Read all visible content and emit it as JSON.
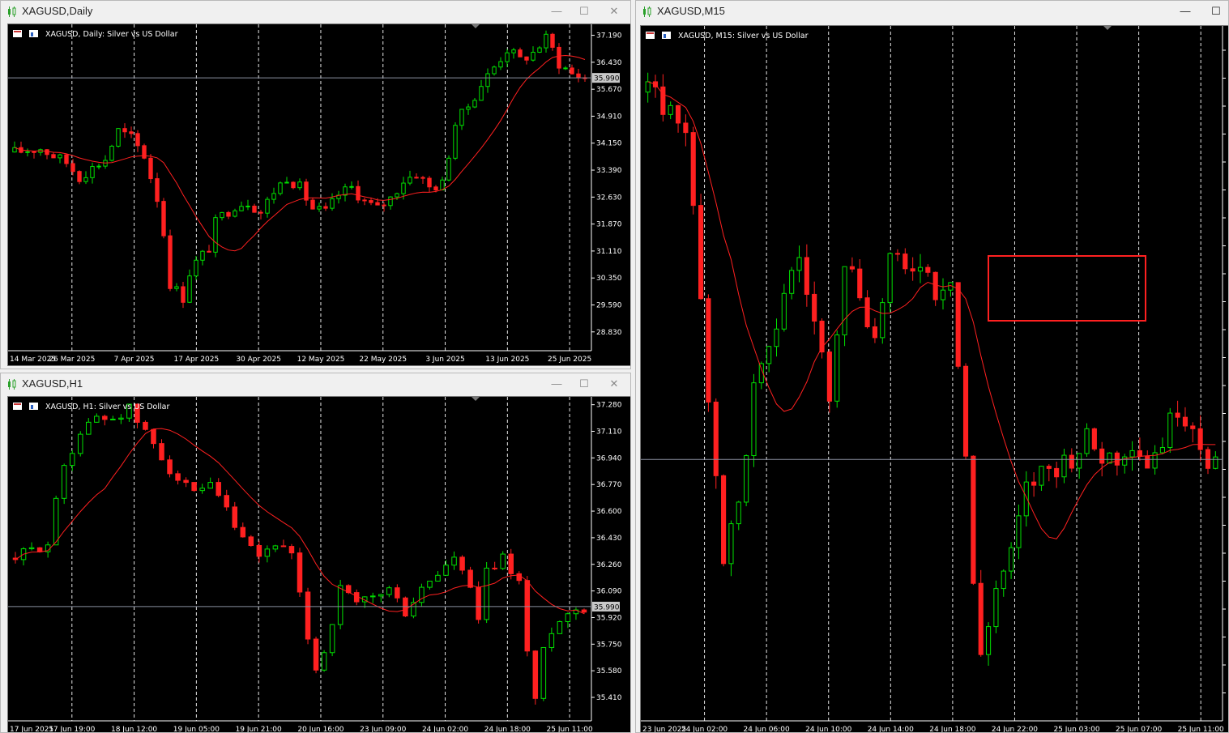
{
  "windows": {
    "daily": {
      "title": "XAGUSD,Daily",
      "chart_header": "XAGUSD, Daily:  Silver vs US Dollar"
    },
    "h1": {
      "title": "XAGUSD,H1",
      "chart_header": "XAGUSD, H1:  Silver vs US Dollar"
    },
    "m15": {
      "title": "XAGUSD,M15",
      "chart_header": "XAGUSD, M15:  Silver vs US Dollar"
    }
  },
  "controls": {
    "minimize": "—",
    "maximize": "☐",
    "close": "✕"
  },
  "colors": {
    "bull": "#00e000",
    "bear": "#ff2020",
    "ma": "#ff2020",
    "grid": "#ffffff",
    "price_line": "#8a8fa0",
    "box": "#ff2020",
    "background": "#000000"
  },
  "current_price": "35.990",
  "chart_data": [
    {
      "type": "candlestick",
      "title": "XAGUSD, Daily:  Silver vs US Dollar",
      "y_ticks": [
        "37.190",
        "36.430",
        "35.670",
        "34.910",
        "34.150",
        "33.390",
        "32.630",
        "31.870",
        "31.110",
        "30.350",
        "29.590",
        "28.830"
      ],
      "ylim": [
        28.3,
        37.5
      ],
      "x_labels": [
        "14 Mar 2025",
        "26 Mar 2025",
        "7 Apr 2025",
        "17 Apr 2025",
        "30 Apr 2025",
        "12 May 2025",
        "22 May 2025",
        "3 Jun 2025",
        "13 Jun 2025",
        "25 Jun 2025"
      ],
      "price_label": "35.990",
      "moving_average": true,
      "grid": "vertical dashed",
      "close_path": [
        [
          0,
          33.9
        ],
        [
          4,
          34.0
        ],
        [
          8,
          33.6
        ],
        [
          10,
          33.2
        ],
        [
          14,
          33.7
        ],
        [
          16,
          34.5
        ],
        [
          18,
          34.3
        ],
        [
          20,
          33.8
        ],
        [
          22,
          32.6
        ],
        [
          23,
          31.6
        ],
        [
          24,
          30.2
        ],
        [
          26,
          29.8
        ],
        [
          27,
          30.5
        ],
        [
          28,
          30.8
        ],
        [
          30,
          31.2
        ],
        [
          31,
          31.9
        ],
        [
          32,
          32.1
        ],
        [
          34,
          32.4
        ],
        [
          36,
          32.5
        ],
        [
          38,
          32.2
        ],
        [
          40,
          32.8
        ],
        [
          42,
          33.2
        ],
        [
          44,
          32.9
        ],
        [
          46,
          32.3
        ],
        [
          48,
          32.2
        ],
        [
          50,
          32.7
        ],
        [
          52,
          32.9
        ],
        [
          54,
          32.5
        ],
        [
          56,
          32.3
        ],
        [
          58,
          32.6
        ],
        [
          60,
          33.1
        ],
        [
          62,
          33.3
        ],
        [
          64,
          32.9
        ],
        [
          66,
          33.0
        ],
        [
          68,
          34.7
        ],
        [
          70,
          35.2
        ],
        [
          72,
          35.8
        ],
        [
          74,
          36.3
        ],
        [
          76,
          36.8
        ],
        [
          78,
          36.5
        ],
        [
          80,
          36.7
        ],
        [
          82,
          37.1
        ],
        [
          83,
          36.8
        ],
        [
          84,
          36.4
        ],
        [
          86,
          36.1
        ],
        [
          88,
          35.99
        ]
      ],
      "candles": 89
    },
    {
      "type": "candlestick",
      "title": "XAGUSD, H1:  Silver vs US Dollar",
      "y_ticks": [
        "37.280",
        "37.110",
        "36.940",
        "36.770",
        "36.600",
        "36.430",
        "36.260",
        "36.090",
        "35.920",
        "35.750",
        "35.580",
        "35.410"
      ],
      "ylim": [
        35.26,
        37.33
      ],
      "x_labels": [
        "17 Jun 2025",
        "17 Jun 19:00",
        "18 Jun 12:00",
        "19 Jun 05:00",
        "19 Jun 21:00",
        "20 Jun 16:00",
        "23 Jun 09:00",
        "24 Jun 02:00",
        "24 Jun 18:00",
        "25 Jun 11:00"
      ],
      "price_label": "35.990",
      "moving_average": true,
      "grid": "vertical dashed",
      "close_path": [
        [
          0,
          36.3
        ],
        [
          4,
          36.4
        ],
        [
          6,
          36.9
        ],
        [
          8,
          37.1
        ],
        [
          10,
          37.2
        ],
        [
          12,
          37.2
        ],
        [
          14,
          37.25
        ],
        [
          16,
          37.1
        ],
        [
          18,
          36.95
        ],
        [
          20,
          36.8
        ],
        [
          22,
          36.7
        ],
        [
          24,
          36.75
        ],
        [
          26,
          36.6
        ],
        [
          28,
          36.4
        ],
        [
          30,
          36.3
        ],
        [
          32,
          36.4
        ],
        [
          34,
          36.3
        ],
        [
          36,
          35.8
        ],
        [
          37,
          35.6
        ],
        [
          38,
          35.7
        ],
        [
          40,
          36.1
        ],
        [
          42,
          36.0
        ],
        [
          44,
          36.05
        ],
        [
          46,
          36.1
        ],
        [
          48,
          35.95
        ],
        [
          50,
          36.1
        ],
        [
          52,
          36.2
        ],
        [
          54,
          36.3
        ],
        [
          56,
          36.1
        ],
        [
          57,
          35.9
        ],
        [
          58,
          36.2
        ],
        [
          60,
          36.3
        ],
        [
          62,
          36.15
        ],
        [
          63,
          35.7
        ],
        [
          64,
          35.4
        ],
        [
          65,
          35.7
        ],
        [
          66,
          35.85
        ],
        [
          68,
          35.95
        ],
        [
          70,
          35.99
        ]
      ],
      "candles": 71
    },
    {
      "type": "candlestick",
      "title": "XAGUSD, M15:  Silver vs US Dollar",
      "y_ticks": [],
      "ylim": [
        35.2,
        37.3
      ],
      "x_labels": [
        "23 Jun 2025",
        "24 Jun 02:00",
        "24 Jun 06:00",
        "24 Jun 10:00",
        "24 Jun 14:00",
        "24 Jun 18:00",
        "24 Jun 22:00",
        "25 Jun 03:00",
        "25 Jun 07:00",
        "25 Jun 11:00"
      ],
      "price_label": "",
      "moving_average": true,
      "grid": "vertical dashed",
      "annotation": "red rectangle around consolidation zone",
      "close_path": [
        [
          0,
          37.1
        ],
        [
          5,
          37.0
        ],
        [
          8,
          36.2
        ],
        [
          10,
          35.7
        ],
        [
          12,
          35.85
        ],
        [
          14,
          36.2
        ],
        [
          16,
          36.3
        ],
        [
          18,
          36.5
        ],
        [
          20,
          36.6
        ],
        [
          22,
          36.4
        ],
        [
          24,
          36.2
        ],
        [
          26,
          36.6
        ],
        [
          28,
          36.5
        ],
        [
          30,
          36.35
        ],
        [
          32,
          36.6
        ],
        [
          34,
          36.55
        ],
        [
          36,
          36.6
        ],
        [
          38,
          36.5
        ],
        [
          40,
          36.55
        ],
        [
          42,
          36.0
        ],
        [
          43,
          35.6
        ],
        [
          44,
          35.4
        ],
        [
          46,
          35.6
        ],
        [
          48,
          35.7
        ],
        [
          50,
          35.9
        ],
        [
          52,
          35.95
        ],
        [
          54,
          35.97
        ],
        [
          56,
          36.0
        ],
        [
          58,
          36.05
        ],
        [
          60,
          36.0
        ],
        [
          62,
          36.0
        ],
        [
          64,
          36.05
        ],
        [
          66,
          35.98
        ],
        [
          68,
          36.05
        ],
        [
          70,
          36.15
        ],
        [
          72,
          36.1
        ],
        [
          74,
          35.99
        ]
      ],
      "candles": 76
    }
  ]
}
